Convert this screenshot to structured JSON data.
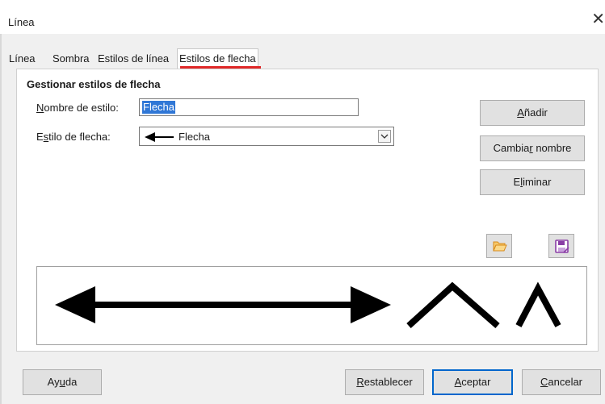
{
  "window": {
    "title": "Línea",
    "close_glyph": "✕"
  },
  "tabs": [
    {
      "label": "Línea",
      "active": false
    },
    {
      "label": "Sombra",
      "active": false
    },
    {
      "label": "Estilos de línea",
      "active": false
    },
    {
      "label": "Estilos de flecha",
      "active": true
    }
  ],
  "section": {
    "title": "Gestionar estilos de flecha"
  },
  "form": {
    "style_name": {
      "label_pre": "",
      "label_mnemonic": "N",
      "label_post": "ombre de estilo:",
      "value": "Flecha"
    },
    "arrow_style": {
      "label_pre": "E",
      "label_mnemonic": "s",
      "label_post": "tilo de flecha:",
      "selected": "Flecha",
      "icon": "arrow-left-icon"
    }
  },
  "side_buttons": {
    "add": {
      "pre": "",
      "mn": "A",
      "post": "ñadir"
    },
    "rename": {
      "pre": "Cambia",
      "mn": "r",
      "post": " nombre"
    },
    "delete": {
      "pre": "E",
      "mn": "l",
      "post": "iminar"
    }
  },
  "icons": {
    "open": "folder-open-icon",
    "save": "save-icon"
  },
  "preview_shapes": [
    "double-arrow-icon",
    "open-chevron-icon",
    "narrow-chevron-icon"
  ],
  "bottom_buttons": {
    "help": {
      "pre": "Ay",
      "mn": "u",
      "post": "da"
    },
    "reset": {
      "pre": "",
      "mn": "R",
      "post": "establecer"
    },
    "ok": {
      "pre": "",
      "mn": "A",
      "post": "ceptar"
    },
    "cancel": {
      "pre": "",
      "mn": "C",
      "post": "ancelar"
    }
  },
  "colors": {
    "accent": "#0066cc",
    "tab_indicator": "#e02828",
    "selection": "#3077d6",
    "folder": "#e8a33a",
    "save": "#8a3ea6"
  }
}
